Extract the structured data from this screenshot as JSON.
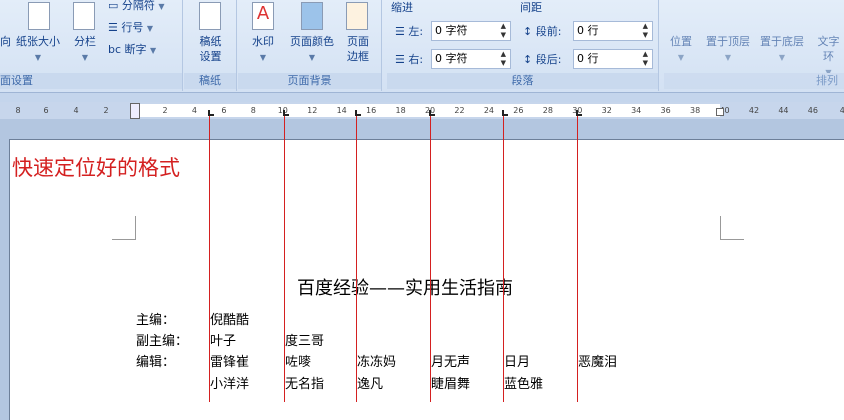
{
  "ribbon": {
    "page_setup": {
      "orientation_partial": "向",
      "size": "纸张大小",
      "columns": "分栏",
      "breaks": "分隔符",
      "line_numbers": "行号",
      "hyphenation": "断字",
      "label": "面设置"
    },
    "manuscript": {
      "button_l1": "稿纸",
      "button_l2": "设置",
      "label": "稿纸"
    },
    "background": {
      "watermark": "水印",
      "page_color": "页面颜色",
      "border_l1": "页面",
      "border_l2": "边框",
      "label": "页面背景"
    },
    "paragraph": {
      "indent_title": "缩进",
      "left_label": "左:",
      "left_value": "0 字符",
      "right_label": "右:",
      "right_value": "0 字符",
      "spacing_title": "间距",
      "before_label": "段前:",
      "before_value": "0 行",
      "after_label": "段后:",
      "after_value": "0 行",
      "label": "段落"
    },
    "arrange": {
      "position": "位置",
      "front": "置于顶层",
      "back": "置于底层",
      "wrap": "文字环",
      "label": "排列"
    }
  },
  "ruler": {
    "ticks_left": [
      "8",
      "6",
      "4",
      "2"
    ],
    "ticks_right": [
      "2",
      "4",
      "6",
      "8",
      "10",
      "12",
      "14",
      "16",
      "18",
      "20",
      "22",
      "24",
      "26",
      "28",
      "30",
      "32",
      "34",
      "36",
      "38",
      "40",
      "42",
      "44",
      "46",
      "4"
    ]
  },
  "document": {
    "annotation": "快速定位好的格式",
    "title": "百度经验——实用生活指南",
    "rows": [
      {
        "label": "主编：",
        "names": [
          "倪酷酷"
        ]
      },
      {
        "label": "副主编：",
        "names": [
          "叶子",
          "度三哥"
        ]
      },
      {
        "label": "编辑：",
        "names": [
          "雷锋崔",
          "咗嘜",
          "冻冻妈",
          "月无声",
          "日月",
          "恶魔泪"
        ]
      },
      {
        "label": "",
        "names": [
          "小洋洋",
          "无名指",
          "逸凡",
          "睫眉舞",
          "蓝色雅"
        ]
      }
    ]
  },
  "colors": {
    "annotation": "#d42020",
    "tab_lines": "#d42020"
  }
}
